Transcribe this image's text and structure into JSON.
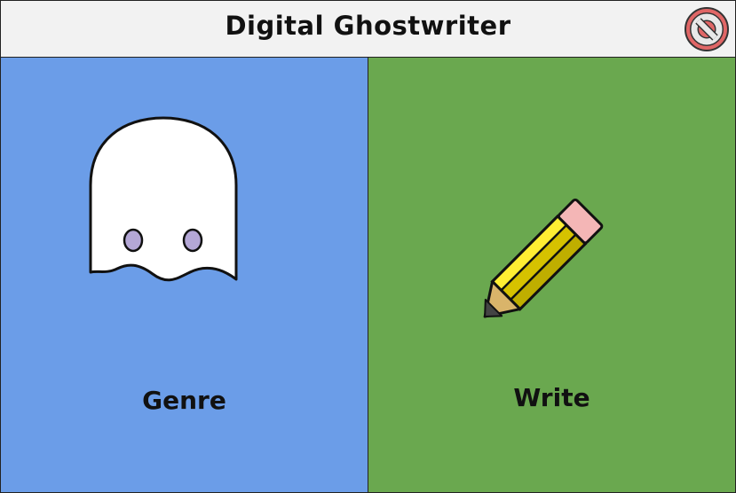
{
  "window": {
    "title": "Digital Ghostwriter",
    "close_icon": "no-entry-icon"
  },
  "panels": [
    {
      "label": "Genre",
      "icon": "ghost-icon",
      "color": "#6b9de8"
    },
    {
      "label": "Write",
      "icon": "pencil-icon",
      "color": "#6aa84f"
    }
  ],
  "colors": {
    "titlebar": "#f2f2f2",
    "close": "#e06666"
  }
}
